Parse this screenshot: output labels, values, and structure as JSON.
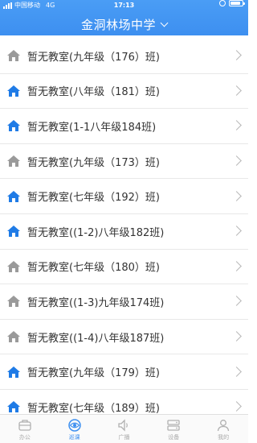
{
  "status_bar": {
    "carrier": "中国移动",
    "network": "4G",
    "time": "17:13",
    "battery_level": 0.85
  },
  "header": {
    "title": "金洞林场中学"
  },
  "colors": {
    "accent": "#3d8ff0",
    "icon_blue": "#1f7be6",
    "icon_gray": "#9a9a9a"
  },
  "rooms": [
    {
      "label": "暂无教室(九年级（176）班)",
      "icon": "home-icon",
      "active": false
    },
    {
      "label": "暂无教室(八年级（181）班)",
      "icon": "home-icon",
      "active": true
    },
    {
      "label": "暂无教室(1-1八年级184班)",
      "icon": "home-icon",
      "active": true
    },
    {
      "label": "暂无教室(九年级（173）班)",
      "icon": "home-icon",
      "active": false
    },
    {
      "label": "暂无教室(七年级（192）班)",
      "icon": "home-icon",
      "active": true
    },
    {
      "label": "暂无教室((1-2)八年级182班)",
      "icon": "home-icon",
      "active": true
    },
    {
      "label": "暂无教室(七年级（180）班)",
      "icon": "home-icon",
      "active": false
    },
    {
      "label": "暂无教室((1-3)九年级174班)",
      "icon": "home-icon",
      "active": false
    },
    {
      "label": "暂无教室((1-4)八年级187班)",
      "icon": "home-icon",
      "active": false
    },
    {
      "label": "暂无教室(九年级（179）班)",
      "icon": "home-icon",
      "active": true
    },
    {
      "label": "暂无教室(七年级（189）班)",
      "icon": "home-icon",
      "active": true
    }
  ],
  "tabs": [
    {
      "label": "办公",
      "icon": "briefcase-icon",
      "active": false
    },
    {
      "label": "巡课",
      "icon": "eye-icon",
      "active": true
    },
    {
      "label": "广播",
      "icon": "speaker-icon",
      "active": false
    },
    {
      "label": "设备",
      "icon": "device-icon",
      "active": false
    },
    {
      "label": "我的",
      "icon": "person-icon",
      "active": false
    }
  ]
}
